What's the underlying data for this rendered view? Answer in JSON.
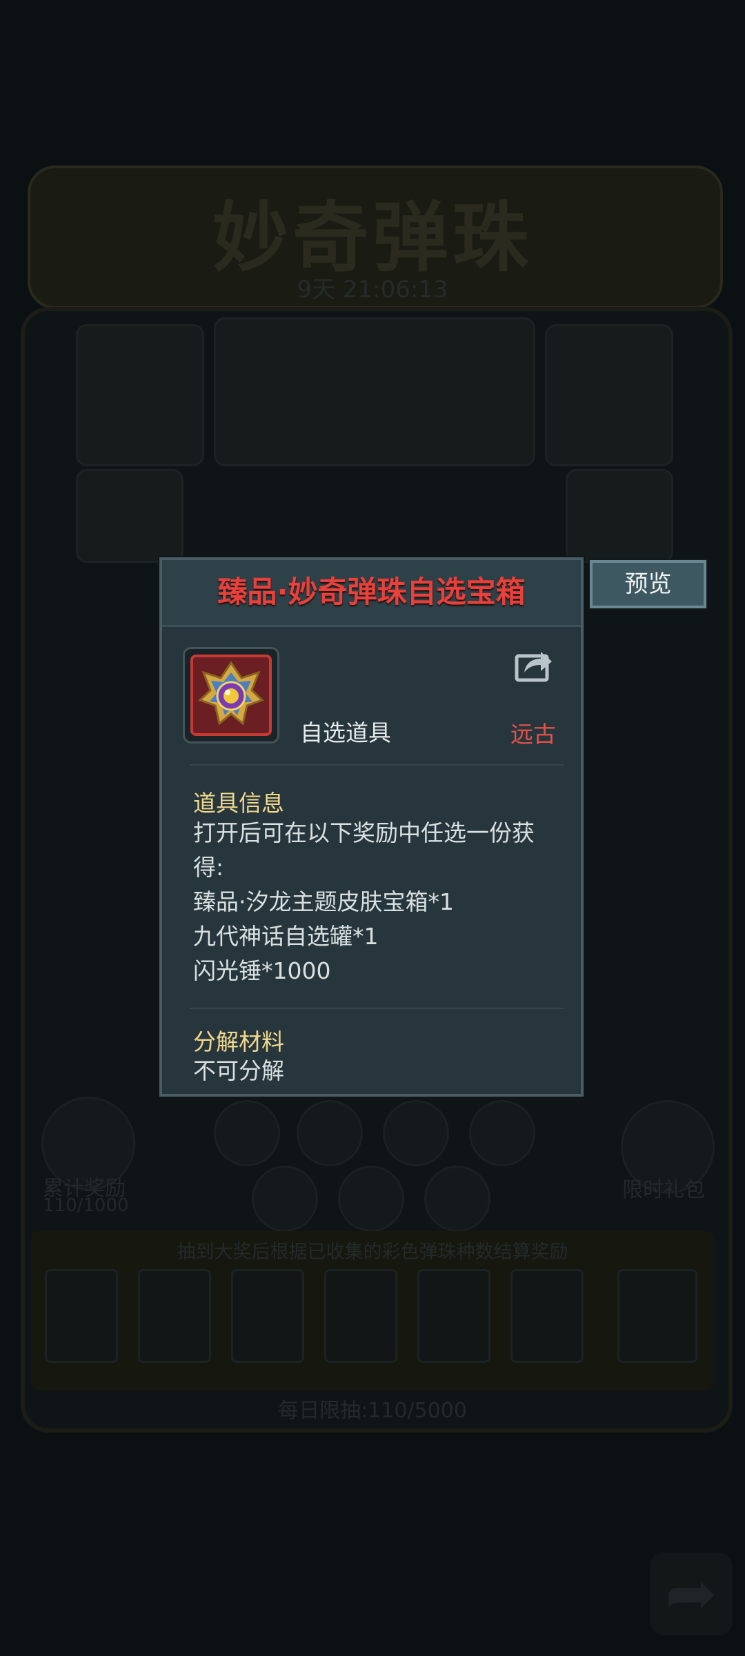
{
  "background": {
    "event_title": "妙奇弹珠",
    "timer": "9天 21:06:13",
    "left_reward_label": "累计奖励",
    "left_reward_count": "110/1000",
    "right_gift_label": "限时礼包",
    "strip_notice": "抽到大奖后根据已收集的彩色弹珠种数结算奖励",
    "daily_limit": "每日限抽:110/5000"
  },
  "dialog": {
    "title": "臻品·妙奇弹珠自选宝箱",
    "preview_button": "预览",
    "item_type": "自选道具",
    "rarity": "远古",
    "info_title": "道具信息",
    "description_lines": [
      "打开后可在以下奖励中任选一份获",
      "得:",
      "臻品·汐龙主题皮肤宝箱*1",
      "九代神话自选罐*1",
      "闪光锤*1000"
    ],
    "decompose_title": "分解材料",
    "decompose_value": "不可分解"
  },
  "colors": {
    "title_red": "#e8403a",
    "rarity_red": "#e2524a",
    "section_gold": "#f1d88d",
    "dialog_bg": "#27363c"
  },
  "icons": {
    "share": "share-icon",
    "item": "treasure-chest-icon"
  }
}
